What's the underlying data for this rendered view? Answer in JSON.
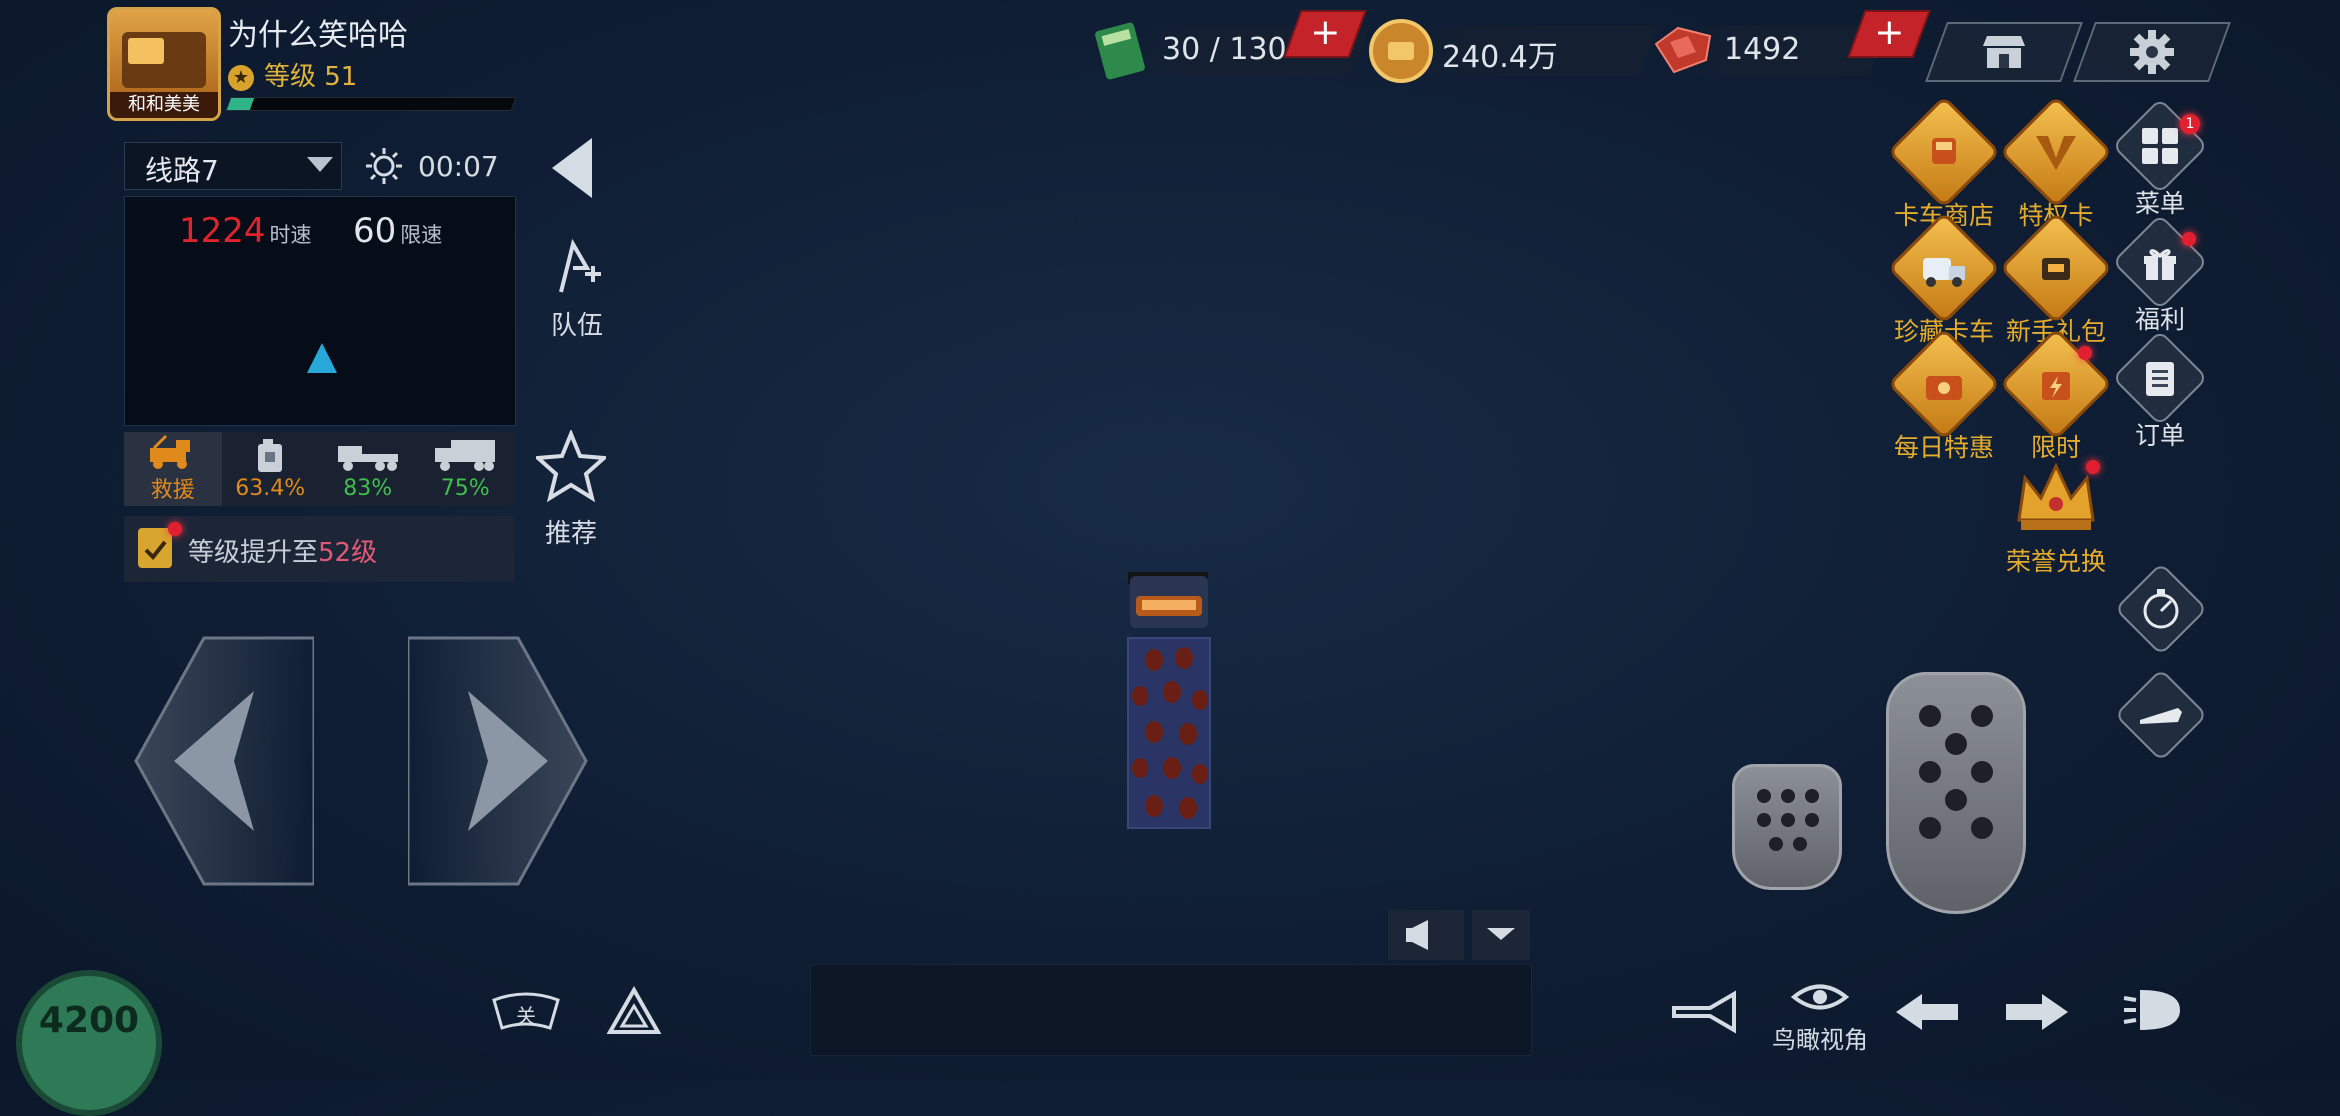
{
  "player": {
    "avatar_tag": "和和美美",
    "name": "为什么笑哈哈",
    "level_label": "等级 51",
    "xp_progress": 0.08
  },
  "currency": {
    "fuel": "30 / 130",
    "coins": "240.4万",
    "gems": "1492",
    "plus": "+"
  },
  "route": {
    "selected": "线路7",
    "time": "00:07"
  },
  "minimap": {
    "speed_value": "1224",
    "speed_label": "时速",
    "limit_value": "60",
    "limit_label": "限速"
  },
  "status": [
    {
      "label": "救援",
      "color": "#e08a1c",
      "icon": "tow-truck-icon"
    },
    {
      "label": "63.4%",
      "color": "#e08a1c",
      "icon": "fuel-can-icon"
    },
    {
      "label": "83%",
      "color": "#3fbf4a",
      "icon": "trailer-icon"
    },
    {
      "label": "75%",
      "color": "#3fbf4a",
      "icon": "truck-icon"
    }
  ],
  "task": {
    "prefix": "等级提升至",
    "level": "52级"
  },
  "side": {
    "team": "队伍",
    "recommend": "推荐"
  },
  "grid": {
    "truck_shop": "卡车商店",
    "privilege_card": "特权卡",
    "menu": "菜单",
    "menu_badge": "1",
    "rare_truck": "珍藏卡车",
    "newbie_pack": "新手礼包",
    "welfare": "福利",
    "daily_deal": "每日特惠",
    "limited": "限时",
    "orders": "订单",
    "honor_exchange": "荣誉兑换"
  },
  "bottom": {
    "wiper_label": "关",
    "birdseye": "鸟瞰视角",
    "gauge_value": "4200"
  },
  "colors": {
    "gold": "#e6ac2c",
    "red_accent": "#c4232a",
    "level_up": "#e05a78"
  }
}
